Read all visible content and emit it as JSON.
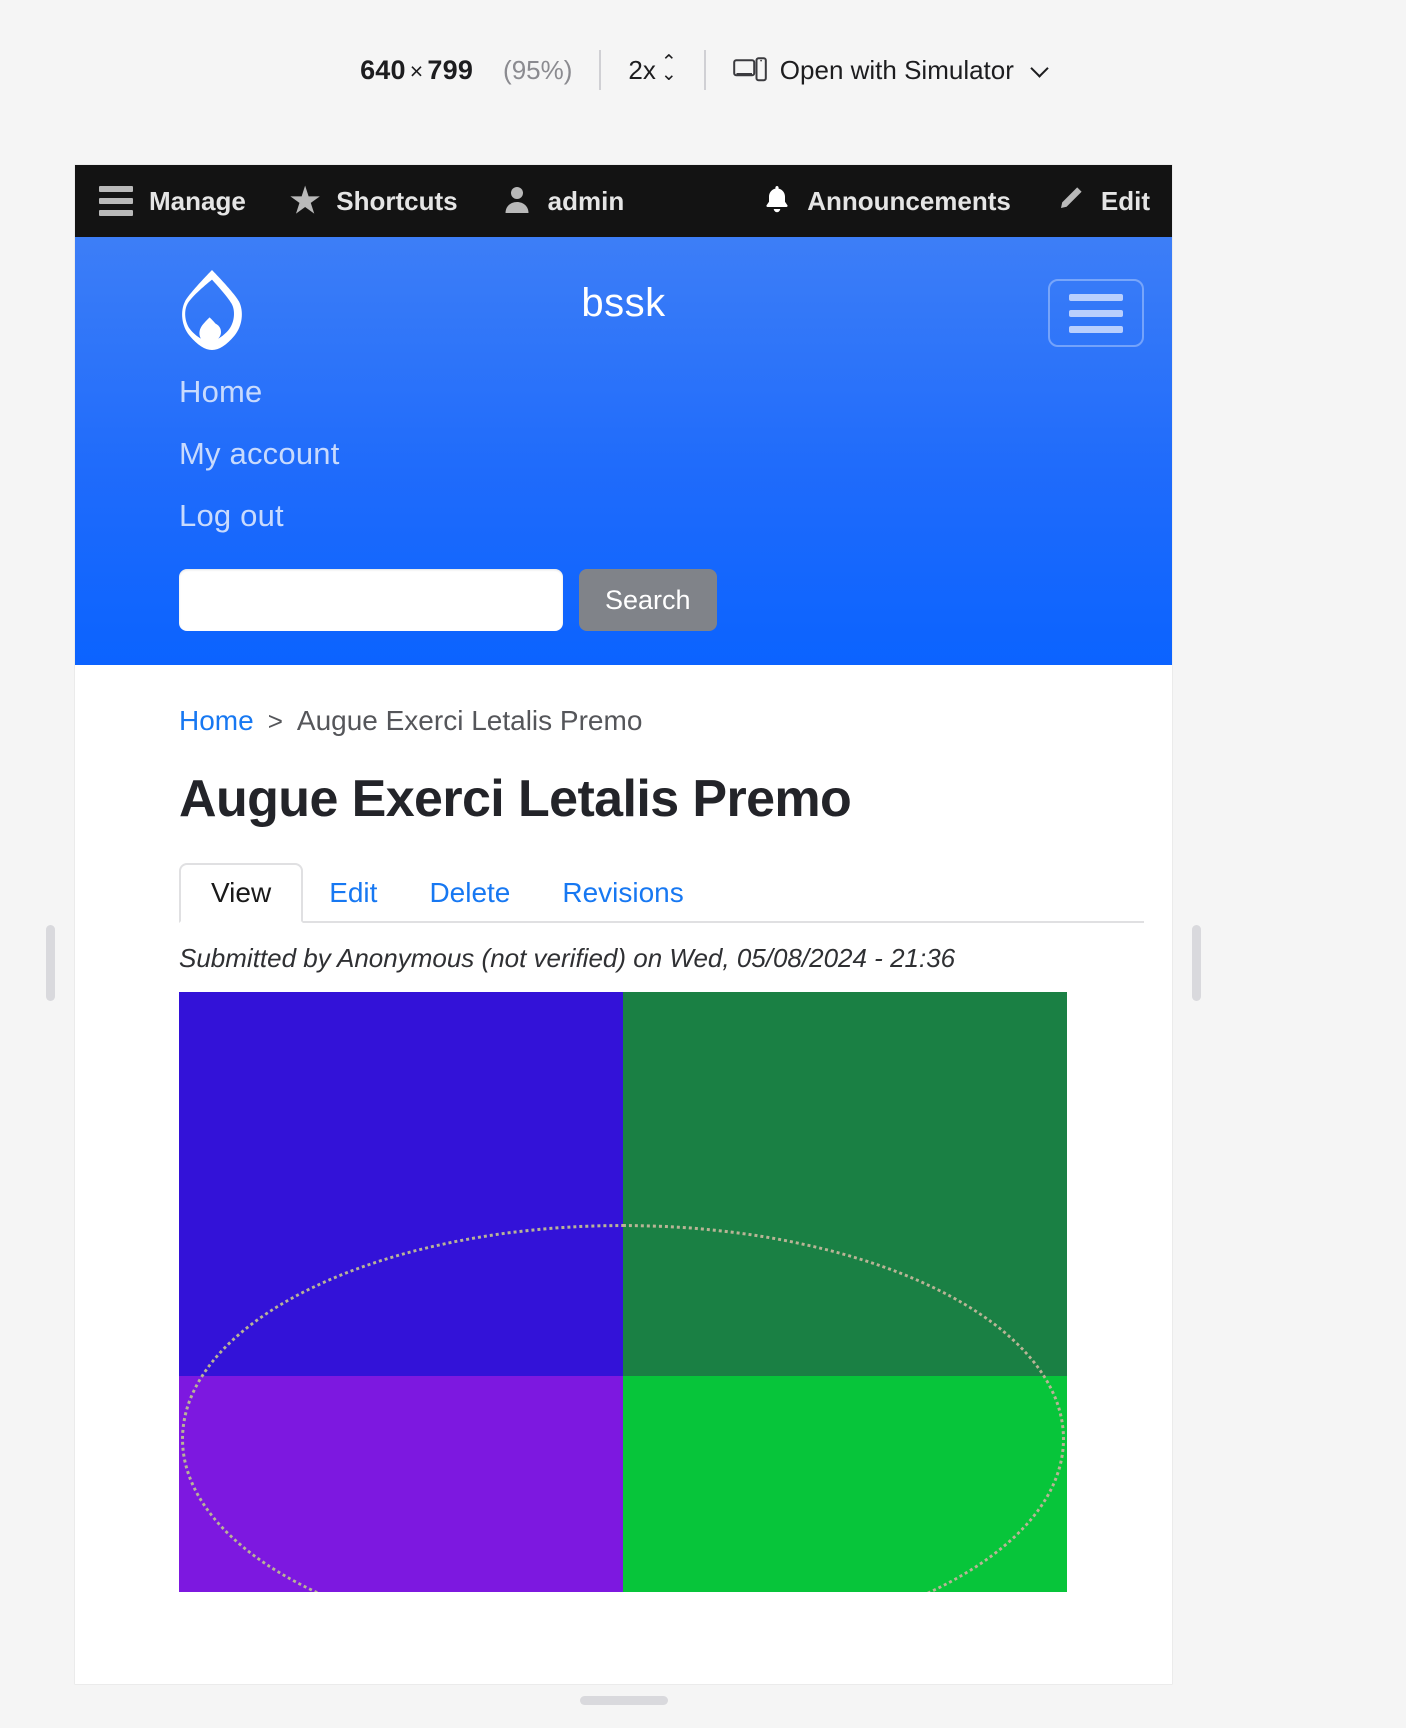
{
  "preview_toolbar": {
    "width": "640",
    "times": "×",
    "height": "799",
    "zoom_percent": "(95%)",
    "scale": "2x",
    "stepper_up": "⌃",
    "stepper_down": "⌄",
    "simulator_icon": "device-icon",
    "simulator_label": "Open with Simulator"
  },
  "admin_toolbar": {
    "items": [
      {
        "label": "Manage",
        "icon": "hamburger-icon"
      },
      {
        "label": "Shortcuts",
        "icon": "star-icon"
      },
      {
        "label": "admin",
        "icon": "person-icon"
      },
      {
        "label": "Announcements",
        "icon": "bell-icon"
      },
      {
        "label": "Edit",
        "icon": "pencil-icon"
      }
    ],
    "star_glyph": "★",
    "person_glyph": "👤",
    "bell_glyph": "🔔",
    "pencil_glyph": "✏"
  },
  "site_header": {
    "logo": "drupal-drop-logo",
    "site_name": "bssk",
    "menu_button": "hamburger-menu-button",
    "nav": [
      {
        "label": "Home"
      },
      {
        "label": "My account"
      },
      {
        "label": "Log out"
      }
    ],
    "search": {
      "value": "",
      "placeholder": "",
      "button_label": "Search"
    },
    "background_color": "#1f6bfb"
  },
  "page": {
    "breadcrumb": {
      "home": "Home",
      "separator": ">",
      "current": "Augue Exerci Letalis Premo"
    },
    "title": "Augue Exerci Letalis Premo",
    "tabs": [
      {
        "label": "View",
        "active": true
      },
      {
        "label": "Edit",
        "active": false
      },
      {
        "label": "Delete",
        "active": false
      },
      {
        "label": "Revisions",
        "active": false
      }
    ],
    "submitted": "Submitted by Anonymous (not verified) on Wed, 05/08/2024 - 21:36",
    "image": {
      "name": "color-quadrant-ellipse-image",
      "quadrant_top_left": "#3312d8",
      "quadrant_top_right": "#1a8044",
      "quadrant_bottom_left": "#7d18e0",
      "quadrant_bottom_right": "#07c53a",
      "ellipse_stroke": "#b9b496"
    }
  },
  "colors": {
    "accent_link": "#1778f2",
    "header_blue": "#1f6bfb",
    "toolbar_black": "#131313",
    "search_button_gray": "#808389"
  }
}
